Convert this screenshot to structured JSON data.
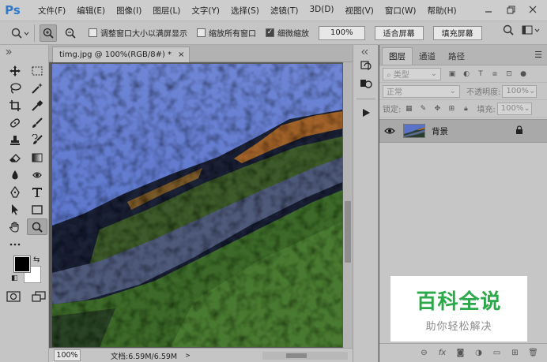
{
  "app": {
    "logo": "Ps",
    "menu": [
      "文件(F)",
      "编辑(E)",
      "图像(I)",
      "图层(L)",
      "文字(Y)",
      "选择(S)",
      "滤镜(T)",
      "3D(D)",
      "视图(V)",
      "窗口(W)",
      "帮助(H)"
    ],
    "window_controls": [
      "minimize-icon",
      "restore-icon",
      "close-icon"
    ]
  },
  "options": {
    "checkbox_resize_label": "调整窗口大小以满屏显示",
    "checkbox_resize_checked": false,
    "checkbox_all_windows_label": "缩放所有窗口",
    "checkbox_all_windows_checked": false,
    "checkbox_scrubby_label": "细微缩放",
    "checkbox_scrubby_checked": true,
    "zoom_value": "100%",
    "fit_screen_label": "适合屏幕",
    "fill_screen_label": "填充屏幕"
  },
  "document": {
    "tab_title": "timg.jpg @ 100%(RGB/8#) *",
    "close_glyph": "×"
  },
  "status": {
    "zoom": "100%",
    "doc_info": "文档:6.59M/6.59M",
    "arrow": ">"
  },
  "layers_panel": {
    "tabs": [
      "图层",
      "通道",
      "路径"
    ],
    "active_tab": 0,
    "filter_kind": "类型",
    "blend_mode": "正常",
    "opacity_label": "不透明度:",
    "opacity_value": "100%",
    "lock_label": "锁定:",
    "fill_label": "填充:",
    "fill_value": "100%",
    "layers": [
      {
        "name": "背景",
        "visible": true,
        "locked": true
      }
    ]
  },
  "watermark": {
    "title": "百科全说",
    "subtitle": "助你轻松解决",
    "color": "#2aa84a"
  },
  "colors": {
    "foreground": "#000000",
    "background": "#ffffff"
  }
}
